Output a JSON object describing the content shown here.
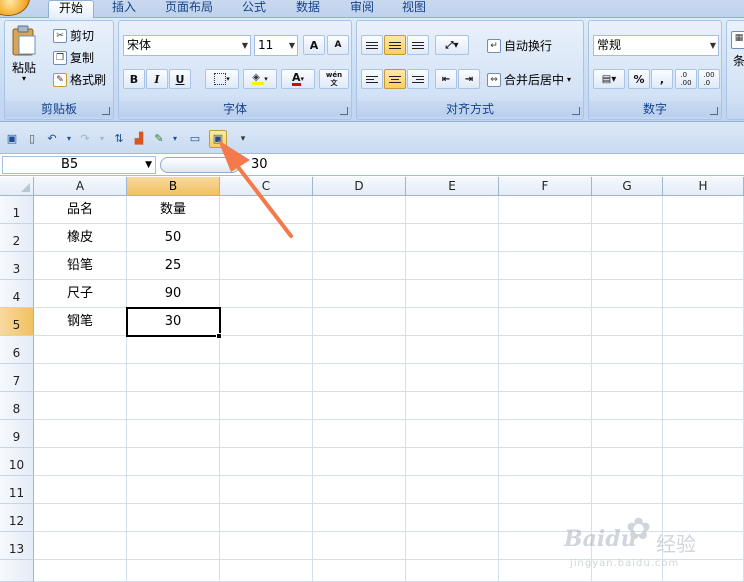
{
  "tabs": [
    {
      "label": "开始",
      "active": true
    },
    {
      "label": "插入"
    },
    {
      "label": "页面布局"
    },
    {
      "label": "公式"
    },
    {
      "label": "数据"
    },
    {
      "label": "审阅"
    },
    {
      "label": "视图"
    }
  ],
  "ribbon": {
    "clipboard": {
      "label": "剪贴板",
      "paste": "粘贴",
      "cut": "剪切",
      "copy": "复制",
      "format_painter": "格式刷"
    },
    "font": {
      "label": "字体",
      "font_name": "宋体",
      "font_size": "11",
      "bold": "B",
      "italic": "I",
      "underline": "U",
      "grow": "A",
      "shrink": "A",
      "font_color": "A",
      "phonetic": "wén\n文"
    },
    "alignment": {
      "label": "对齐方式",
      "wrap_text": "自动换行",
      "merge_center": "合并后居中"
    },
    "number": {
      "label": "数字",
      "format": "常规",
      "percent": "%",
      "comma": ",",
      "inc_decimal": ".0\n.00",
      "dec_decimal": ".00\n.0"
    },
    "styles": {
      "partial_label": "条"
    }
  },
  "formula_bar": {
    "name_box": "B5",
    "value": "30"
  },
  "columns": [
    "A",
    "B",
    "C",
    "D",
    "E",
    "F",
    "G",
    "H"
  ],
  "selected_column": "B",
  "rows": [
    "1",
    "2",
    "3",
    "4",
    "5",
    "6",
    "7",
    "8",
    "9",
    "10",
    "11",
    "12",
    "13"
  ],
  "selected_row": "5",
  "cells": [
    [
      "品名",
      "数量"
    ],
    [
      "橡皮",
      "50"
    ],
    [
      "铅笔",
      "25"
    ],
    [
      "尺子",
      "90"
    ],
    [
      "钢笔",
      "30"
    ]
  ],
  "annotation": {
    "arrow_color": "#f47a4b"
  },
  "watermark": {
    "brand": "Baidu",
    "jingyan": "经验",
    "url": "jingyan.baidu.com"
  },
  "colors": {
    "ribbon": "#c7daf2",
    "accent": "#15428b",
    "selected_header": "#f1c15f"
  }
}
